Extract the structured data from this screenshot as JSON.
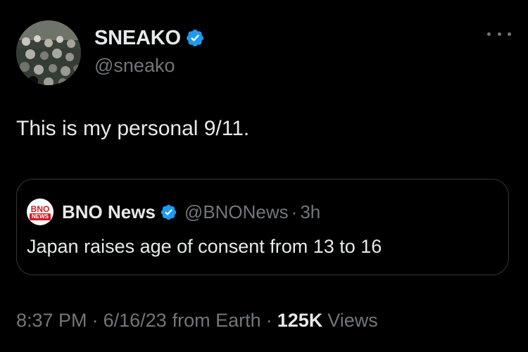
{
  "author": {
    "display_name": "SNEAKO",
    "handle": "@sneako",
    "verified": true
  },
  "tweet": {
    "text": "This is my personal 9/11."
  },
  "quoted_tweet": {
    "logo_top": "BNO",
    "logo_bottom": "NEWS",
    "display_name": "BNO News",
    "handle": "@BNONews",
    "separator": "·",
    "time": "3h",
    "text": "Japan raises age of consent from 13 to 16"
  },
  "meta": {
    "time": "8:37 PM",
    "separator": "·",
    "date": "6/16/23",
    "source": "from Earth",
    "views_count": "125K",
    "views_label": "Views"
  },
  "colors": {
    "background": "#000000",
    "primary_text": "#e7e9ea",
    "secondary_text": "#71767b",
    "verified_blue": "#1d9bf0",
    "border": "#333639",
    "bno_red": "#d71920"
  },
  "icons": {
    "verified": "verified-badge-icon",
    "more": "more-horizontal-icon"
  }
}
